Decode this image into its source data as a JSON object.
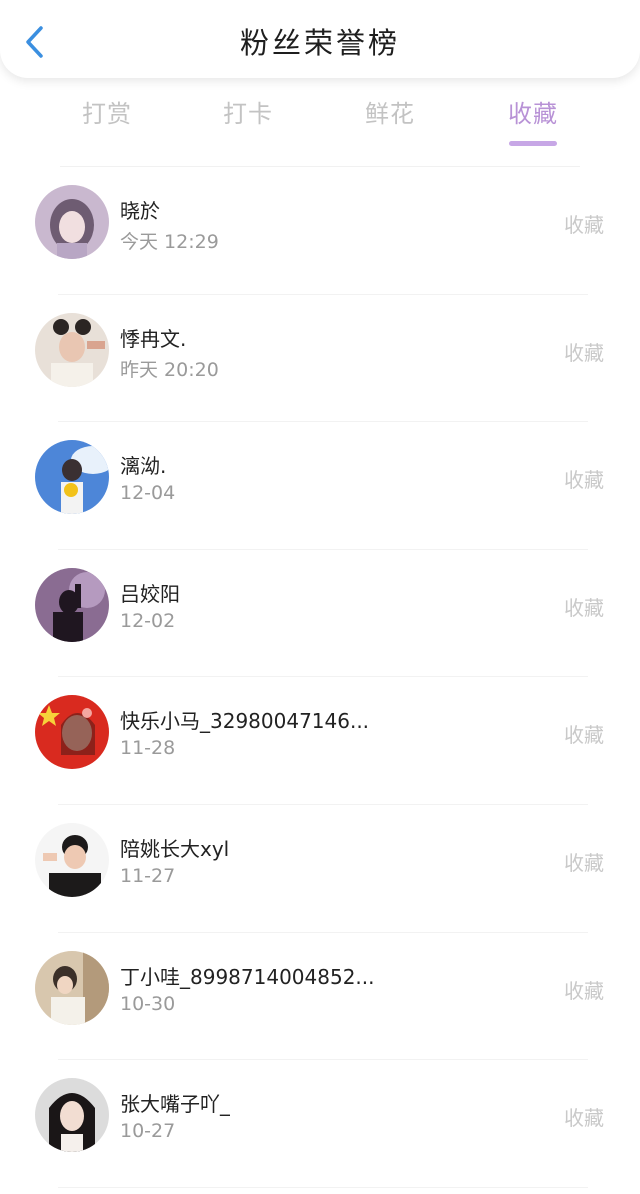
{
  "header": {
    "title": "粉丝荣誉榜",
    "back_icon": "chevron-left-icon",
    "accent_color": "#3b8fe0"
  },
  "tabs": [
    {
      "label": "打赏",
      "active": false
    },
    {
      "label": "打卡",
      "active": false
    },
    {
      "label": "鲜花",
      "active": false
    },
    {
      "label": "收藏",
      "active": true
    }
  ],
  "active_tab_color": "#b892d6",
  "fans": [
    {
      "name": "晓於",
      "time": "今天 12:29",
      "action": "收藏"
    },
    {
      "name": "悸冉文.",
      "time": "昨天 20:20",
      "action": "收藏"
    },
    {
      "name": "漓泑.",
      "time": "12-04",
      "action": "收藏"
    },
    {
      "name": "吕姣阳",
      "time": "12-02",
      "action": "收藏"
    },
    {
      "name": "快乐小马_32980047146...",
      "time": "11-28",
      "action": "收藏"
    },
    {
      "name": "陪姚长大xyl",
      "time": "11-27",
      "action": "收藏"
    },
    {
      "name": "丁小哇_8998714004852...",
      "time": "10-30",
      "action": "收藏"
    },
    {
      "name": "张大嘴子吖_",
      "time": "10-27",
      "action": "收藏"
    }
  ]
}
